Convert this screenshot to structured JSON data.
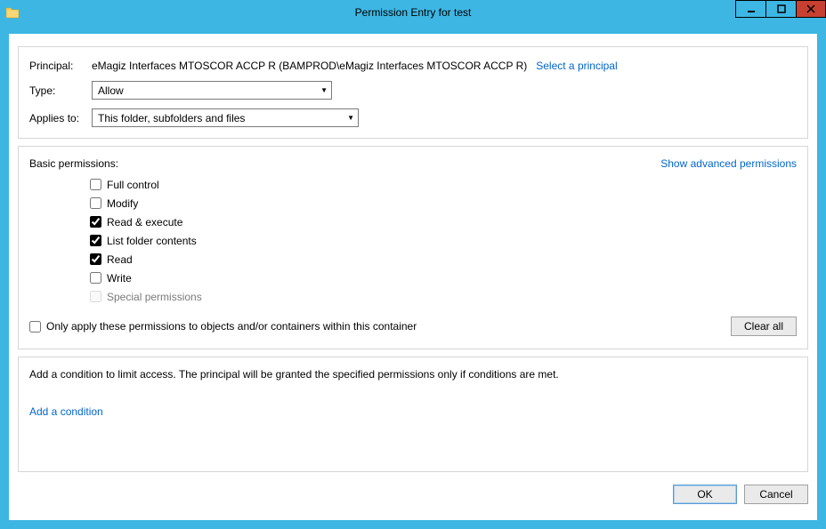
{
  "window": {
    "title": "Permission Entry for test"
  },
  "top": {
    "principal_label": "Principal:",
    "principal_value": "eMagiz Interfaces MTOSCOR ACCP R (BAMPROD\\eMagiz Interfaces MTOSCOR ACCP R)",
    "select_link": "Select a principal",
    "type_label": "Type:",
    "type_value": "Allow",
    "applies_label": "Applies to:",
    "applies_value": "This folder, subfolders and files"
  },
  "permissions": {
    "header": "Basic permissions:",
    "advanced_link": "Show advanced permissions",
    "items": [
      {
        "label": "Full control",
        "checked": false,
        "disabled": false
      },
      {
        "label": "Modify",
        "checked": false,
        "disabled": false
      },
      {
        "label": "Read & execute",
        "checked": true,
        "disabled": false
      },
      {
        "label": "List folder contents",
        "checked": true,
        "disabled": false
      },
      {
        "label": "Read",
        "checked": true,
        "disabled": false
      },
      {
        "label": "Write",
        "checked": false,
        "disabled": false
      },
      {
        "label": "Special permissions",
        "checked": false,
        "disabled": true
      }
    ],
    "only_apply_label": "Only apply these permissions to objects and/or containers within this container",
    "only_apply_checked": false,
    "clear_all": "Clear all"
  },
  "condition": {
    "text": "Add a condition to limit access. The principal will be granted the specified permissions only if conditions are met.",
    "link": "Add a condition"
  },
  "footer": {
    "ok": "OK",
    "cancel": "Cancel"
  }
}
